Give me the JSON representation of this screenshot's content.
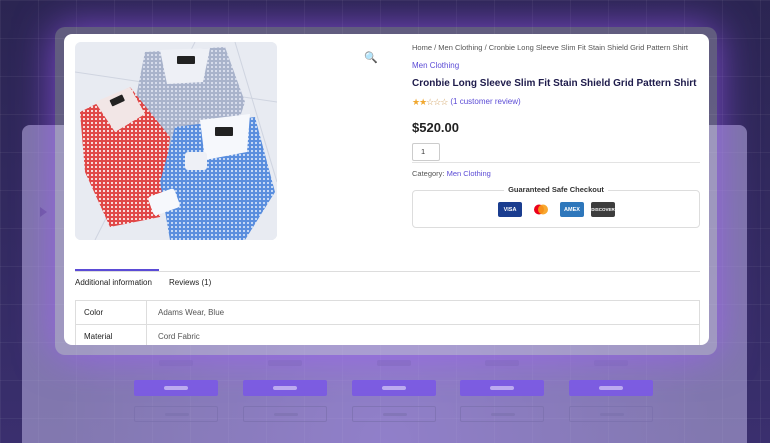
{
  "breadcrumb": {
    "home": "Home",
    "sep1": " / ",
    "category": "Men Clothing",
    "sep2": " / ",
    "current": "Cronbie Long Sleeve Slim Fit Stain Shield Grid Pattern Shirt"
  },
  "product": {
    "category_link": "Men Clothing",
    "title": "Cronbie Long Sleeve Slim Fit Stain Shield Grid Pattern Shirt",
    "rating_filled": 2,
    "rating_max": 5,
    "review_link": "(1 customer review)",
    "price": "$520.00",
    "quantity": "1",
    "category_label": "Category: ",
    "category_value": "Men Clothing"
  },
  "checkout": {
    "legend": "Guaranteed Safe Checkout",
    "methods": [
      "VISA",
      "mastercard",
      "AMEX",
      "DISCOVER"
    ]
  },
  "tabs": [
    {
      "label": "Additional information",
      "active": true
    },
    {
      "label": "Reviews (1)",
      "active": false
    }
  ],
  "attributes": [
    {
      "label": "Color",
      "value": "Adams Wear, Blue"
    },
    {
      "label": "Material",
      "value": "Cord Fabric"
    }
  ],
  "colors": {
    "accent": "#5b4bd6",
    "star": "#f0a830",
    "glow": "#a05aff"
  },
  "icons": {
    "zoom": "magnifier-icon"
  }
}
